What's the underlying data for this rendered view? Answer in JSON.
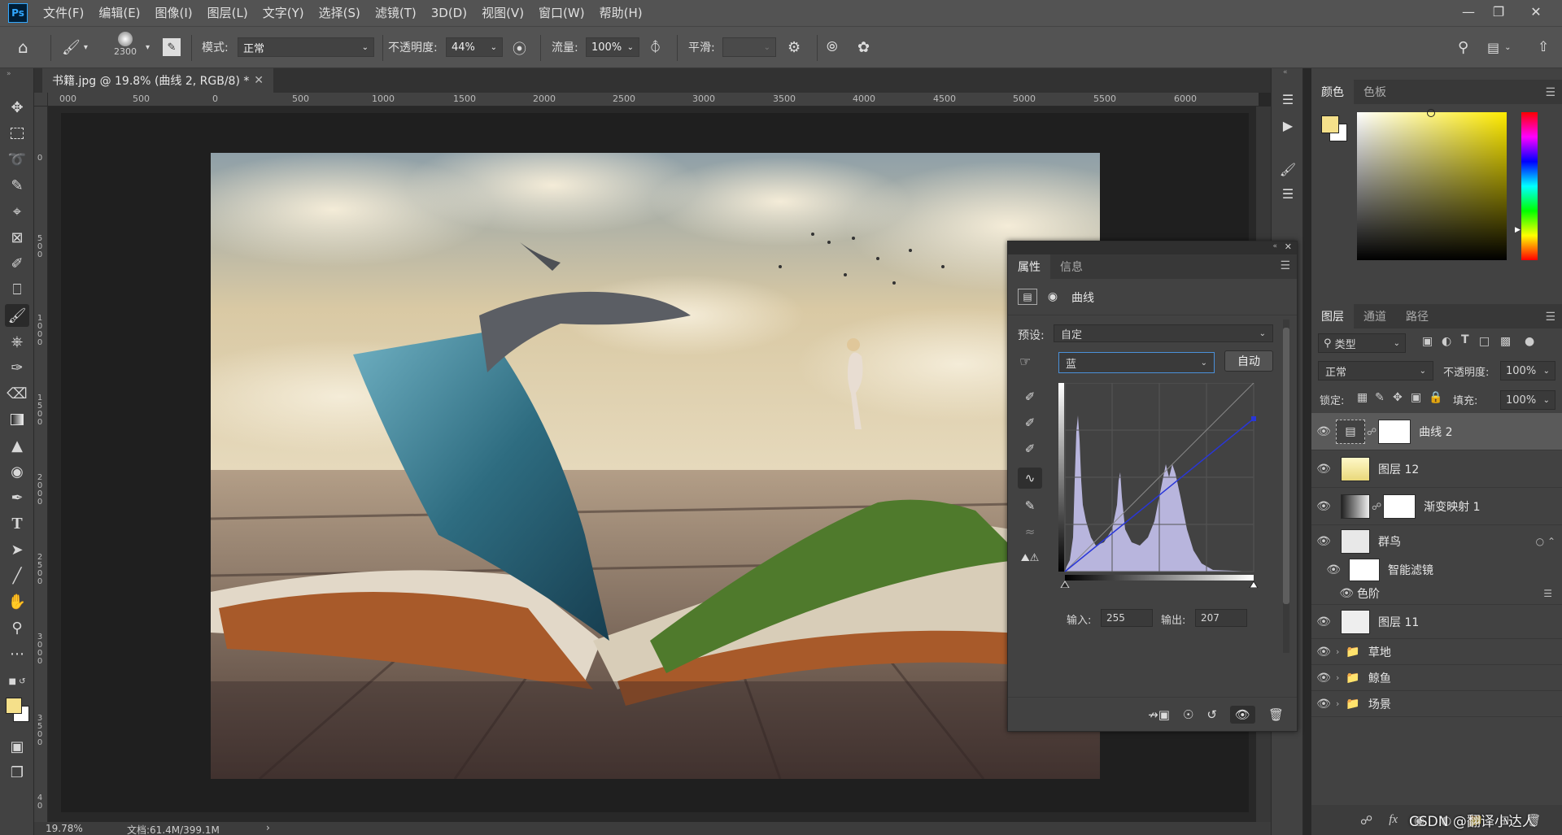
{
  "app": {
    "logo": "Ps"
  },
  "menu": [
    "文件(F)",
    "编辑(E)",
    "图像(I)",
    "图层(L)",
    "文字(Y)",
    "选择(S)",
    "滤镜(T)",
    "3D(D)",
    "视图(V)",
    "窗口(W)",
    "帮助(H)"
  ],
  "options": {
    "brush_size": "2300",
    "mode_label": "模式:",
    "mode_value": "正常",
    "opacity_label": "不透明度:",
    "opacity_value": "44%",
    "flow_label": "流量:",
    "flow_value": "100%",
    "smooth_label": "平滑:"
  },
  "document": {
    "tab_title": "书籍.jpg @ 19.8% (曲线 2, RGB/8) *",
    "zoom": "19.78%",
    "doc_info": "文档:61.4M/399.1M"
  },
  "ruler": {
    "h_labels": [
      "000",
      "500",
      "0",
      "500",
      "1000",
      "1500",
      "2000",
      "2500",
      "3000",
      "3500",
      "4000",
      "4500",
      "5000",
      "5500",
      "6000"
    ],
    "v_labels": [
      "0",
      "5\n0\n0",
      "1\n0\n0\n0",
      "1\n5\n0\n0",
      "2\n0\n0\n0",
      "2\n5\n0\n0",
      "3\n0\n0\n0",
      "3\n5\n0\n0",
      "4\n0"
    ]
  },
  "color_panel": {
    "tabs": [
      "颜色",
      "色板"
    ],
    "foreground": "#f5e08a",
    "background": "#ffffff"
  },
  "layers_panel": {
    "tabs": [
      "图层",
      "通道",
      "路径"
    ],
    "filter_type": "类型",
    "blend_mode": "正常",
    "opacity_label": "不透明度:",
    "opacity_value": "100%",
    "lock_label": "锁定:",
    "fill_label": "填充:",
    "fill_value": "100%",
    "layers": [
      {
        "name": "曲线 2",
        "kind": "adjustment"
      },
      {
        "name": "图层 12",
        "kind": "pixel"
      },
      {
        "name": "渐变映射 1",
        "kind": "adjustment"
      },
      {
        "name": "群鸟",
        "kind": "smart"
      },
      {
        "name": "智能滤镜",
        "kind": "filter"
      },
      {
        "name": "色阶",
        "kind": "filter-item"
      },
      {
        "name": "图层 11",
        "kind": "pixel"
      },
      {
        "name": "草地",
        "kind": "group"
      },
      {
        "name": "鲸鱼",
        "kind": "group"
      },
      {
        "name": "场景",
        "kind": "group"
      }
    ]
  },
  "properties_panel": {
    "tabs": [
      "属性",
      "信息"
    ],
    "adjustment_name": "曲线",
    "preset_label": "预设:",
    "preset_value": "自定",
    "channel_value": "蓝",
    "auto_button": "自动",
    "input_label": "输入:",
    "input_value": "255",
    "output_label": "输出:",
    "output_value": "207"
  },
  "watermark": "CSDN @翻译小达人"
}
